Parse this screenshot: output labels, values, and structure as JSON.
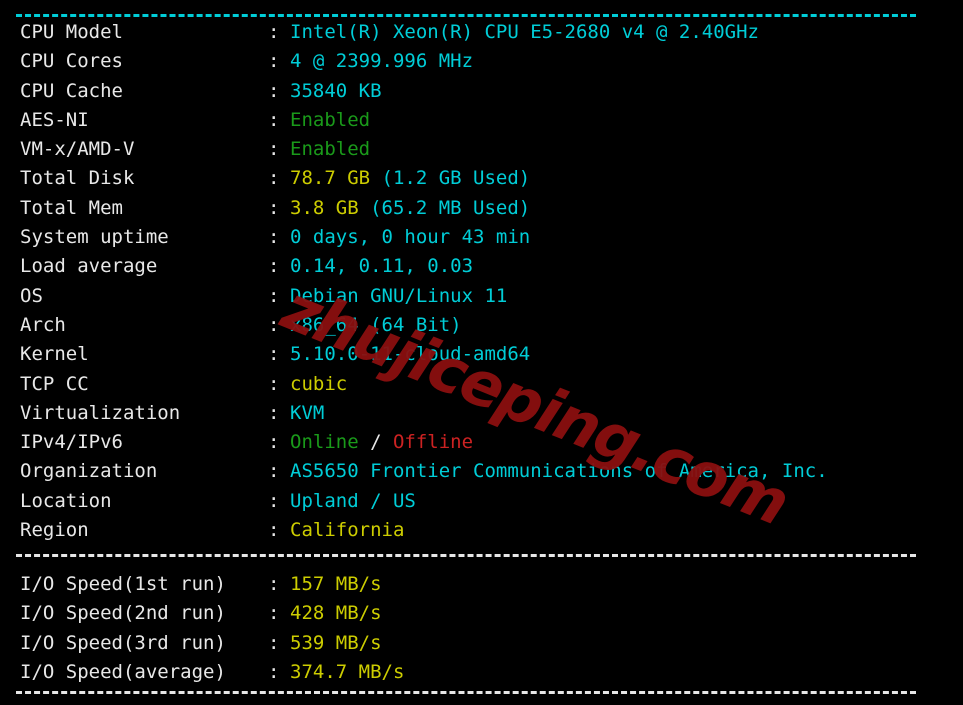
{
  "terminal": {
    "background": "#000000",
    "watermark_text": "zhujiceping.com",
    "watermark_color": "#8b0f0f",
    "separator_top": "----------------------------------------------------------------------",
    "separator_middle": "----------------------------------------------------------------------",
    "separator_bottom": "----------------------------------------------------------------------",
    "colon": ":"
  },
  "colors": {
    "cyan": "#00cdd7",
    "yellow": "#cdcd00",
    "green": "#1a9a1a",
    "red": "#cc2222",
    "white": "#e8e8e8"
  },
  "system_info": [
    {
      "label": "CPU Model",
      "value": "Intel(R) Xeon(R) CPU E5-2680 v4 @ 2.40GHz",
      "color": "cyan"
    },
    {
      "label": "CPU Cores",
      "value": "4 @ 2399.996 MHz",
      "color": "cyan"
    },
    {
      "label": "CPU Cache",
      "value": "35840 KB",
      "color": "cyan"
    },
    {
      "label": "AES-NI",
      "value": "Enabled",
      "color": "green"
    },
    {
      "label": "VM-x/AMD-V",
      "value": "Enabled",
      "color": "green"
    },
    {
      "label": "Total Disk",
      "value": "78.7 GB",
      "color": "yellow",
      "value2": " (1.2 GB Used)",
      "color2": "cyan"
    },
    {
      "label": "Total Mem",
      "value": "3.8 GB",
      "color": "yellow",
      "value2": " (65.2 MB Used)",
      "color2": "cyan"
    },
    {
      "label": "System uptime",
      "value": "0 days, 0 hour 43 min",
      "color": "cyan"
    },
    {
      "label": "Load average",
      "value": "0.14, 0.11, 0.03",
      "color": "cyan"
    },
    {
      "label": "OS",
      "value": "Debian GNU/Linux 11",
      "color": "cyan"
    },
    {
      "label": "Arch",
      "value": "x86_64 (64 Bit)",
      "color": "cyan"
    },
    {
      "label": "Kernel",
      "value": "5.10.0-11-cloud-amd64",
      "color": "cyan"
    },
    {
      "label": "TCP CC",
      "value": "cubic",
      "color": "yellow"
    },
    {
      "label": "Virtualization",
      "value": "KVM",
      "color": "cyan"
    },
    {
      "label": "IPv4/IPv6",
      "value": "Online",
      "color": "green",
      "value2": " / ",
      "color2": "white",
      "value3": "Offline",
      "color3": "red"
    },
    {
      "label": "Organization",
      "value": "AS5650 Frontier Communications of America, Inc.",
      "color": "cyan"
    },
    {
      "label": "Location",
      "value": "Upland / US",
      "color": "cyan"
    },
    {
      "label": "Region",
      "value": "California",
      "color": "yellow"
    }
  ],
  "io_speed": [
    {
      "label": "I/O Speed(1st run)",
      "value": "157 MB/s",
      "color": "yellow"
    },
    {
      "label": "I/O Speed(2nd run)",
      "value": "428 MB/s",
      "color": "yellow"
    },
    {
      "label": "I/O Speed(3rd run)",
      "value": "539 MB/s",
      "color": "yellow"
    },
    {
      "label": "I/O Speed(average)",
      "value": "374.7 MB/s",
      "color": "yellow"
    }
  ]
}
